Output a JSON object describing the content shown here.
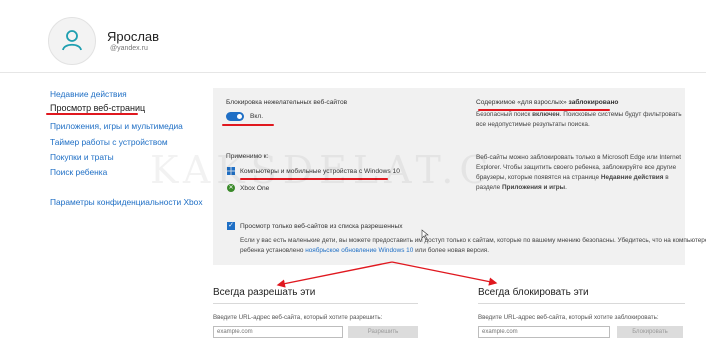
{
  "profile": {
    "name": "Ярослав",
    "email": "@yandex.ru"
  },
  "sidebar": {
    "items": [
      {
        "label": "Недавние действия"
      },
      {
        "label": "Просмотр веб-страниц"
      },
      {
        "label": "Приложения, игры и мультимедиа"
      },
      {
        "label": "Таймер работы с устройством"
      },
      {
        "label": "Покупки и траты"
      },
      {
        "label": "Поиск ребенка"
      },
      {
        "label": "Параметры конфиденциальности Xbox"
      }
    ]
  },
  "panel": {
    "block_title": "Блокировка нежелательных веб-сайтов",
    "toggle_label": "Вкл.",
    "toggle_on": true,
    "applies_title": "Применимо к:",
    "platforms": [
      {
        "label": "Компьютеры и мобильные устройства с Windows 10",
        "icon": "windows-icon"
      },
      {
        "label": "Xbox One",
        "icon": "xbox-icon"
      }
    ],
    "allowed_only_label": "Просмотр только веб-сайтов из списка разрешенных",
    "allowed_only_checked": true,
    "allowed_only_desc_1": "Если у вас есть маленькие дети, вы можете предоставить им доступ только к сайтам, которые по вашему мнению безопасны. Убедитесь, что на компьютере",
    "allowed_only_desc_2_before": "ребенка установлено ",
    "allowed_only_desc_2_link": "ноябрьское обновление Windows 10",
    "allowed_only_desc_2_after": " или более новая версия.",
    "adult_line_prefix": "Содержимое «для взрослых» ",
    "adult_line_bold": "заблокировано",
    "safe_search_prefix": "Безопасный поиск ",
    "safe_search_bold": "включен",
    "safe_search_suffix": ". Поисковые системы будут фильтровать",
    "safe_search_line2": "все недопустимые результаты поиска.",
    "edge_line1": "Веб-сайты можно заблокировать только в Microsoft Edge или Internet",
    "edge_line2": "Explorer. Чтобы защитить своего ребенка, заблокируйте все другие",
    "edge_line3": "браузеры, которые появятся на странице ",
    "edge_line3_bold": "Недавние действия",
    "edge_line3_after": " в",
    "edge_line4_before": "разделе ",
    "edge_line4_bold": "Приложения и игры",
    "edge_line4_after": "."
  },
  "allow_section": {
    "title": "Всегда разрешать эти",
    "desc": "Введите URL-адрес веб-сайта, который хотите разрешить:",
    "placeholder": "example.com",
    "button": "Разрешить"
  },
  "block_section": {
    "title": "Всегда блокировать эти",
    "desc": "Введите URL-адрес веб-сайта, который хотите заблокировать:",
    "placeholder": "example.com",
    "button": "Блокировать"
  },
  "watermark": "KAKSDELAT.C",
  "colors": {
    "accent": "#1f6fc5",
    "annotation": "#e0181f",
    "panel_bg": "#f1f1f1"
  }
}
